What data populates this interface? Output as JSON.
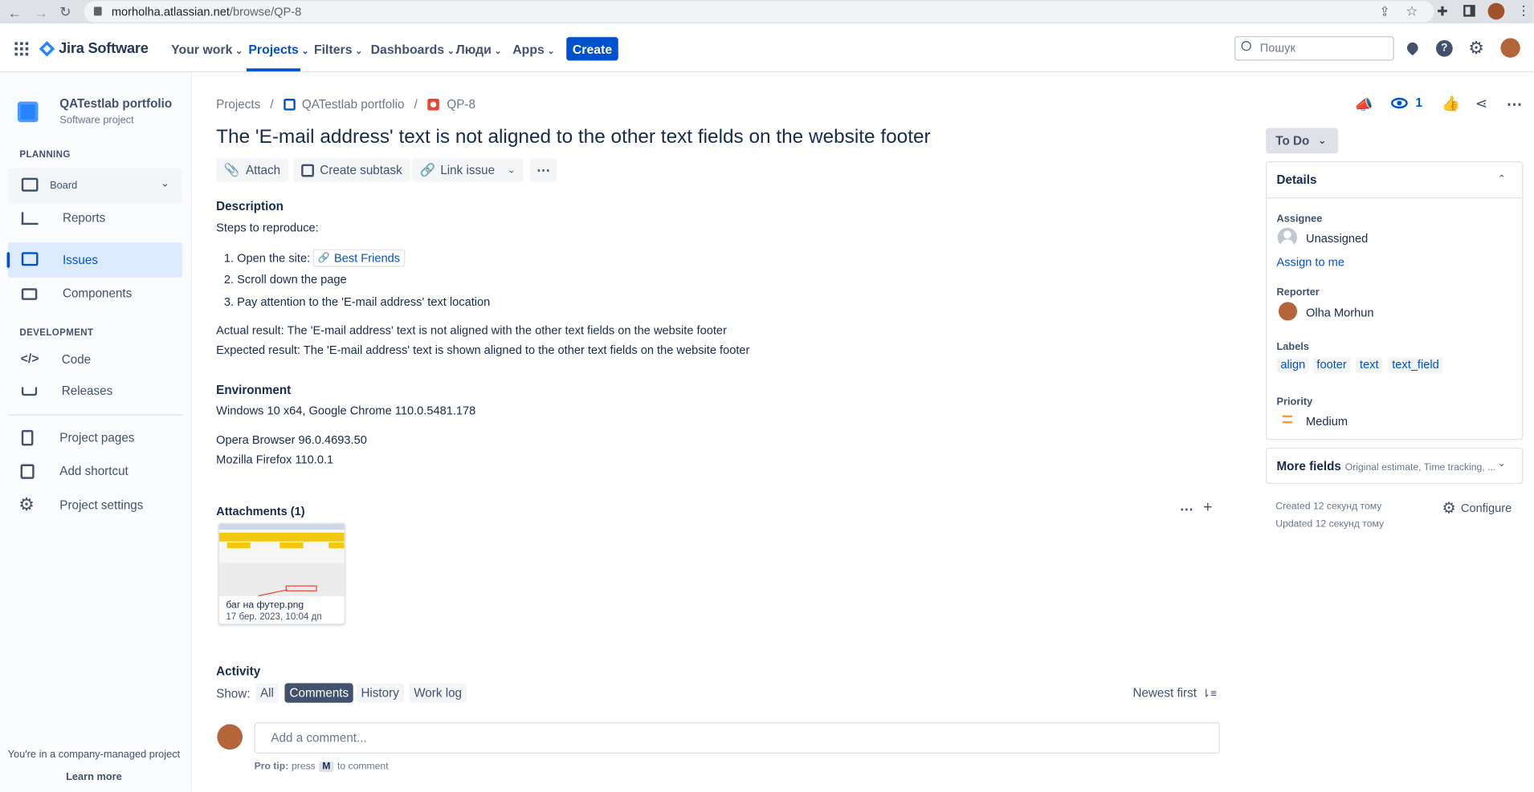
{
  "browser": {
    "url_host": "morholha.atlassian.net",
    "url_path": "/browse/QP-8"
  },
  "nav": {
    "product": "Jira Software",
    "items": [
      "Your work",
      "Projects",
      "Filters",
      "Dashboards",
      "Люди",
      "Apps"
    ],
    "active": "Projects",
    "create_label": "Create",
    "search_placeholder": "Пошук"
  },
  "sidebar": {
    "project_name": "QATestlab portfolio",
    "project_type": "Software project",
    "planning_label": "PLANNING",
    "planning_items": [
      "Board",
      "Reports",
      "Issues",
      "Components"
    ],
    "development_label": "DEVELOPMENT",
    "development_items": [
      "Code",
      "Releases"
    ],
    "other_items": [
      "Project pages",
      "Add shortcut",
      "Project settings"
    ],
    "footer_text": "You're in a company-managed project",
    "learn_more": "Learn more"
  },
  "breadcrumb": [
    "Projects",
    "QATestlab portfolio",
    "QP-8"
  ],
  "issue": {
    "title": "The 'E-mail address' text is not aligned to the other text fields on the website footer",
    "actions": [
      "Attach",
      "Create subtask",
      "Link issue"
    ],
    "watch_count": "1",
    "description_label": "Description",
    "steps_intro": "Steps to reproduce:",
    "step1": "1. Open the site:",
    "step1_link": "Best Friends",
    "step2": "2. Scroll down the page",
    "step3": "3. Pay attention to the 'E-mail address' text location",
    "actual": "Actual result: The 'E-mail address' text is not aligned with the other text fields on the website footer",
    "expected": "Expected result: The 'E-mail address' text is shown aligned to the other text fields on the website footer",
    "environment_label": "Environment",
    "env_line1": "Windows 10 x64, Google Chrome 110.0.5481.178",
    "env_line2": "Opera Browser 96.0.4693.50",
    "env_line3": "Mozilla Firefox 110.0.1",
    "attachments_label": "Attachments (1)",
    "attachment_name": "баг на футер.png",
    "attachment_date": "17 бер. 2023, 10:04 дп"
  },
  "activity": {
    "label": "Activity",
    "show_label": "Show:",
    "tabs": [
      "All",
      "Comments",
      "History",
      "Work log"
    ],
    "active_tab": "Comments",
    "sort_label": "Newest first",
    "comment_placeholder": "Add a comment...",
    "pro_tip_bold": "Pro tip:",
    "pro_tip_press": "press",
    "pro_tip_key": "M",
    "pro_tip_rest": "to comment"
  },
  "details": {
    "status": "To Do",
    "header": "Details",
    "assignee_label": "Assignee",
    "assignee": "Unassigned",
    "assign_to_me": "Assign to me",
    "reporter_label": "Reporter",
    "reporter": "Olha Morhun",
    "labels_label": "Labels",
    "labels": [
      "align",
      "footer",
      "text",
      "text_field"
    ],
    "priority_label": "Priority",
    "priority": "Medium",
    "more_fields": "More fields",
    "more_fields_hint": "Original estimate, Time tracking, ...",
    "created": "Created 12 секунд тому",
    "updated": "Updated 12 секунд тому",
    "configure": "Configure"
  },
  "colors": {
    "accent": "#0052cc",
    "active_nav": "#0052cc",
    "sidebar_selected": "#deebff",
    "priority_medium": "#ff991f"
  }
}
